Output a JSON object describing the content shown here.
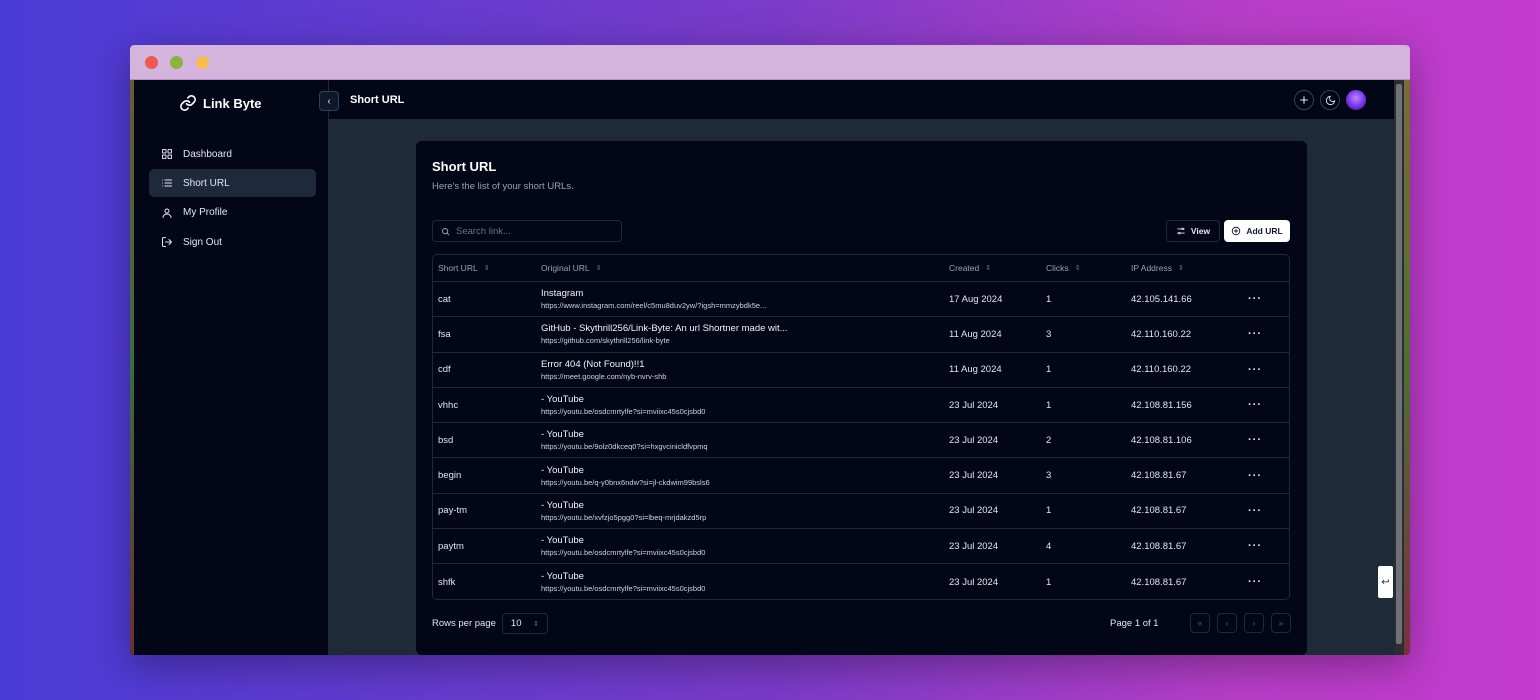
{
  "brand": {
    "name": "Link Byte",
    "icon": "link-icon"
  },
  "sidebar": {
    "items": [
      {
        "label": "Dashboard",
        "icon": "grid-icon"
      },
      {
        "label": "Short URL",
        "icon": "list-icon",
        "active": true
      },
      {
        "label": "My Profile",
        "icon": "user-icon"
      },
      {
        "label": "Sign Out",
        "icon": "logout-icon"
      }
    ]
  },
  "header": {
    "title": "Short URL",
    "collapse_glyph": "‹"
  },
  "card": {
    "title": "Short URL",
    "subtitle": "Here's the list of your short URLs.",
    "search_placeholder": "Search link...",
    "view_label": "View",
    "add_label": "Add URL"
  },
  "table": {
    "columns": [
      "Short URL",
      "Original URL",
      "Created",
      "Clicks",
      "IP Address"
    ],
    "sort_glyph": "⇕",
    "more_glyph": "···",
    "rows": [
      {
        "short": "cat",
        "title": "Instagram",
        "url": "https://www.instagram.com/reel/c5mu8duv2yw/?igsh=mmzybdk5e...",
        "created": "17 Aug 2024",
        "clicks": "1",
        "ip": "42.105.141.66"
      },
      {
        "short": "fsa",
        "title": "GitHub - Skythrill256/Link-Byte: An url Shortner made wit...",
        "url": "https://github.com/skythrill256/link-byte",
        "created": "11 Aug 2024",
        "clicks": "3",
        "ip": "42.110.160.22"
      },
      {
        "short": "cdf",
        "title": "Error 404 (Not Found)!!1",
        "url": "https://meet.google.com/nyb-nvrv-shb",
        "created": "11 Aug 2024",
        "clicks": "1",
        "ip": "42.110.160.22"
      },
      {
        "short": "vhhc",
        "title": "- YouTube",
        "url": "https://youtu.be/osdcmrtylfe?si=mviixc45s0cjsbd0",
        "created": "23 Jul 2024",
        "clicks": "1",
        "ip": "42.108.81.156"
      },
      {
        "short": "bsd",
        "title": "- YouTube",
        "url": "https://youtu.be/9olz0dkceq0?si=hxgvcinicldfvpmq",
        "created": "23 Jul 2024",
        "clicks": "2",
        "ip": "42.108.81.106"
      },
      {
        "short": "begin",
        "title": "- YouTube",
        "url": "https://youtu.be/q-y0bnx6ndw?si=jl-ckdwim99bsls6",
        "created": "23 Jul 2024",
        "clicks": "3",
        "ip": "42.108.81.67"
      },
      {
        "short": "pay-tm",
        "title": "- YouTube",
        "url": "https://youtu.be/xvfzjo5pgg0?si=lbeq-mrjdakzd5rp",
        "created": "23 Jul 2024",
        "clicks": "1",
        "ip": "42.108.81.67"
      },
      {
        "short": "paytm",
        "title": "- YouTube",
        "url": "https://youtu.be/osdcmrtylfe?si=mviixc45s0cjsbd0",
        "created": "23 Jul 2024",
        "clicks": "4",
        "ip": "42.108.81.67"
      },
      {
        "short": "shfk",
        "title": "- YouTube",
        "url": "https://youtu.be/osdcmrtylfe?si=mviixc45s0cjsbd0",
        "created": "23 Jul 2024",
        "clicks": "1",
        "ip": "42.108.81.67"
      }
    ]
  },
  "footer": {
    "rows_per_page_label": "Rows per page",
    "rows_per_page_value": "10",
    "page_info": "Page 1 of 1",
    "first_glyph": "«",
    "prev_glyph": "‹",
    "next_glyph": "›",
    "last_glyph": "»",
    "spinner_glyph": "⇕"
  },
  "floating_tab_glyph": "↩",
  "top_icons": [
    "plus-icon",
    "theme-toggle-icon",
    "avatar"
  ],
  "colors": {
    "background": "#020617",
    "panel": "#1e2a37",
    "accent": "#ffffff",
    "border": "#1e293b"
  }
}
